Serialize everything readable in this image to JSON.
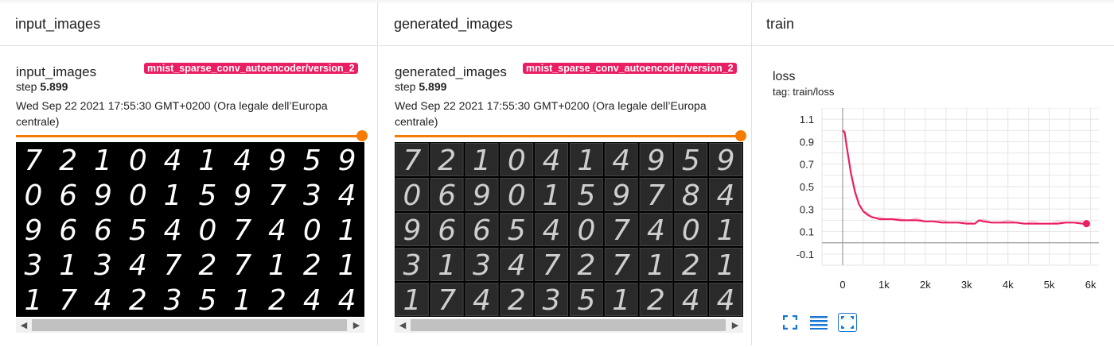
{
  "panels": [
    {
      "header": "input_images",
      "card_title": "input_images",
      "run": "mnist_sparse_conv_autoencoder/version_2",
      "step_label": "step",
      "step_value": "5.899",
      "date": "Wed Sep 22 2021 17:55:30 GMT+0200 (Ora legale dell’Europa centrale)",
      "grid": [
        [
          "7",
          "2",
          "1",
          "0",
          "4",
          "1",
          "4",
          "9",
          "5",
          "9"
        ],
        [
          "0",
          "6",
          "9",
          "0",
          "1",
          "5",
          "9",
          "7",
          "3",
          "4"
        ],
        [
          "9",
          "6",
          "6",
          "5",
          "4",
          "0",
          "7",
          "4",
          "0",
          "1"
        ],
        [
          "3",
          "1",
          "3",
          "4",
          "7",
          "2",
          "7",
          "1",
          "2",
          "1"
        ],
        [
          "1",
          "7",
          "4",
          "2",
          "3",
          "5",
          "1",
          "2",
          "4",
          "4"
        ]
      ]
    },
    {
      "header": "generated_images",
      "card_title": "generated_images",
      "run": "mnist_sparse_conv_autoencoder/version_2",
      "step_label": "step",
      "step_value": "5.899",
      "date": "Wed Sep 22 2021 17:55:30 GMT+0200 (Ora legale dell’Europa centrale)",
      "grid": [
        [
          "7",
          "2",
          "1",
          "0",
          "4",
          "1",
          "4",
          "9",
          "5",
          "9"
        ],
        [
          "0",
          "6",
          "9",
          "0",
          "1",
          "5",
          "9",
          "7",
          "8",
          "4"
        ],
        [
          "9",
          "6",
          "6",
          "5",
          "4",
          "0",
          "7",
          "4",
          "0",
          "1"
        ],
        [
          "3",
          "1",
          "3",
          "4",
          "7",
          "2",
          "7",
          "1",
          "2",
          "1"
        ],
        [
          "1",
          "7",
          "4",
          "2",
          "3",
          "5",
          "1",
          "2",
          "4",
          "4"
        ]
      ]
    }
  ],
  "train": {
    "header": "train",
    "chart_title": "loss",
    "tag": "tag: train/loss"
  },
  "chart_data": {
    "type": "line",
    "title": "loss",
    "xlabel": "",
    "ylabel": "",
    "xlim": [
      -500,
      6200
    ],
    "ylim": [
      -0.2,
      1.2
    ],
    "xticks": [
      "0",
      "1k",
      "2k",
      "3k",
      "4k",
      "5k",
      "6k"
    ],
    "yticks": [
      "1.1",
      "0.9",
      "0.7",
      "0.5",
      "0.3",
      "0.1",
      "-0.1"
    ],
    "grid": true,
    "series": [
      {
        "color": "#e91e63",
        "x": [
          0,
          50,
          100,
          200,
          300,
          400,
          500,
          600,
          700,
          800,
          900,
          1000,
          1200,
          1400,
          1500,
          1600,
          1800,
          2000,
          2200,
          2400,
          2600,
          2800,
          3000,
          3200,
          3300,
          3400,
          3600,
          3800,
          4000,
          4200,
          4400,
          4600,
          4800,
          5000,
          5200,
          5400,
          5600,
          5800,
          5900
        ],
        "y": [
          1.0,
          0.98,
          0.85,
          0.62,
          0.45,
          0.34,
          0.28,
          0.25,
          0.23,
          0.22,
          0.21,
          0.21,
          0.21,
          0.2,
          0.2,
          0.2,
          0.2,
          0.19,
          0.19,
          0.18,
          0.18,
          0.18,
          0.17,
          0.17,
          0.2,
          0.19,
          0.18,
          0.18,
          0.18,
          0.18,
          0.17,
          0.17,
          0.17,
          0.17,
          0.17,
          0.18,
          0.18,
          0.17,
          0.17
        ]
      }
    ]
  },
  "toolbar": {
    "fit": "fullscreen-icon",
    "lines": "toggle-y-log-icon",
    "zoom": "fit-domain-icon"
  }
}
